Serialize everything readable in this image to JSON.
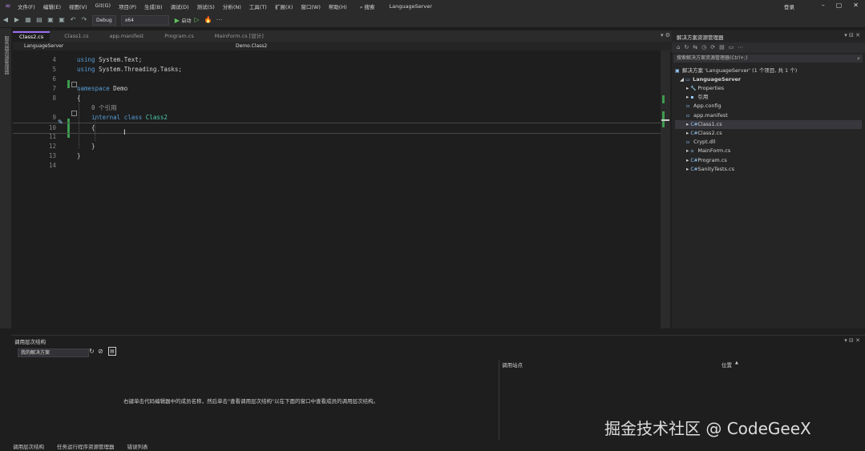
{
  "menubar": {
    "items": [
      "文件(F)",
      "编辑(E)",
      "视图(V)",
      "Git(G)",
      "项目(P)",
      "生成(B)",
      "调试(D)",
      "测试(S)",
      "分析(N)",
      "工具(T)",
      "扩展(X)",
      "窗口(W)",
      "帮助(H)"
    ],
    "search_label": "搜索",
    "solution_title": "LanguageServer",
    "login": "登录"
  },
  "toolbar": {
    "config": "Debug",
    "platform": "x64",
    "run_label": "启动"
  },
  "leftstrip": {
    "label": "服务器资源管理器"
  },
  "tabs": [
    {
      "label": "Class2.cs",
      "active": true
    },
    {
      "label": "Class1.cs",
      "active": false
    },
    {
      "label": "app.manifest",
      "active": false
    },
    {
      "label": "Program.cs",
      "active": false
    },
    {
      "label": "MainForm.cs [设计]",
      "active": false
    }
  ],
  "navbar": {
    "project": "LanguageServer",
    "type": "Demo.Class2"
  },
  "editor": {
    "lines": [
      {
        "n": "4",
        "parts": [
          {
            "t": "using ",
            "c": "kw"
          },
          {
            "t": "System.Text;",
            "c": ""
          }
        ]
      },
      {
        "n": "5",
        "parts": [
          {
            "t": "using ",
            "c": "kw"
          },
          {
            "t": "System.Threading.Tasks;",
            "c": ""
          }
        ]
      },
      {
        "n": "6",
        "parts": []
      },
      {
        "n": "7",
        "parts": [
          {
            "t": "namespace ",
            "c": "kw"
          },
          {
            "t": "Demo",
            "c": ""
          }
        ]
      },
      {
        "n": "8",
        "parts": [
          {
            "t": "{",
            "c": ""
          }
        ]
      },
      {
        "n": "",
        "parts": [
          {
            "t": "    0 个引用",
            "c": "ref"
          }
        ]
      },
      {
        "n": "9",
        "parts": [
          {
            "t": "    internal ",
            "c": "kw"
          },
          {
            "t": "class ",
            "c": "kw"
          },
          {
            "t": "Class2",
            "c": "ty"
          }
        ]
      },
      {
        "n": "10",
        "parts": [
          {
            "t": "    {",
            "c": ""
          }
        ]
      },
      {
        "n": "11",
        "parts": []
      },
      {
        "n": "12",
        "parts": [
          {
            "t": "    }",
            "c": ""
          }
        ]
      },
      {
        "n": "13",
        "parts": [
          {
            "t": "}",
            "c": ""
          }
        ]
      },
      {
        "n": "14",
        "parts": []
      }
    ]
  },
  "solution_explorer": {
    "title": "解决方案资源管理器",
    "search_placeholder": "搜索解决方案资源管理器(Ctrl+;)",
    "solution_line": "解决方案 'LanguageServer' (1 个项目, 共 1 个)",
    "project": "LanguageServer",
    "items": [
      {
        "label": "Properties",
        "icon": "wrench-icon",
        "glyph": "🔧"
      },
      {
        "label": "引用",
        "icon": "references-icon",
        "glyph": "▪"
      },
      {
        "label": "App.config",
        "icon": "config-file-icon",
        "glyph": "▫"
      },
      {
        "label": "app.manifest",
        "icon": "manifest-file-icon",
        "glyph": "▫"
      },
      {
        "label": "Class1.cs",
        "icon": "csharp-file-icon",
        "glyph": "C#"
      },
      {
        "label": "Class2.cs",
        "icon": "csharp-file-icon",
        "glyph": "C#"
      },
      {
        "label": "Crypt.dll",
        "icon": "dll-file-icon",
        "glyph": "▫"
      },
      {
        "label": "MainForm.cs",
        "icon": "form-file-icon",
        "glyph": "▫"
      },
      {
        "label": "Program.cs",
        "icon": "csharp-file-icon",
        "glyph": "C#"
      },
      {
        "label": "SanityTests.cs",
        "icon": "csharp-file-icon",
        "glyph": "C#"
      }
    ]
  },
  "bottom_panel": {
    "title": "调用层次结构",
    "combo": "我的解决方案",
    "message": "右键单击代码编辑器中的成员名称，然后单击\"查看调用层次结构\"以在下面的窗口中查看成员的调用层次结构。",
    "col_details": "调用站点",
    "col_location": "位置"
  },
  "statusbar": {
    "items": [
      "调用层次结构",
      "任务运行程序资源管理器",
      "错误列表"
    ]
  },
  "watermark": "掘金技术社区 @ CodeGeeX"
}
